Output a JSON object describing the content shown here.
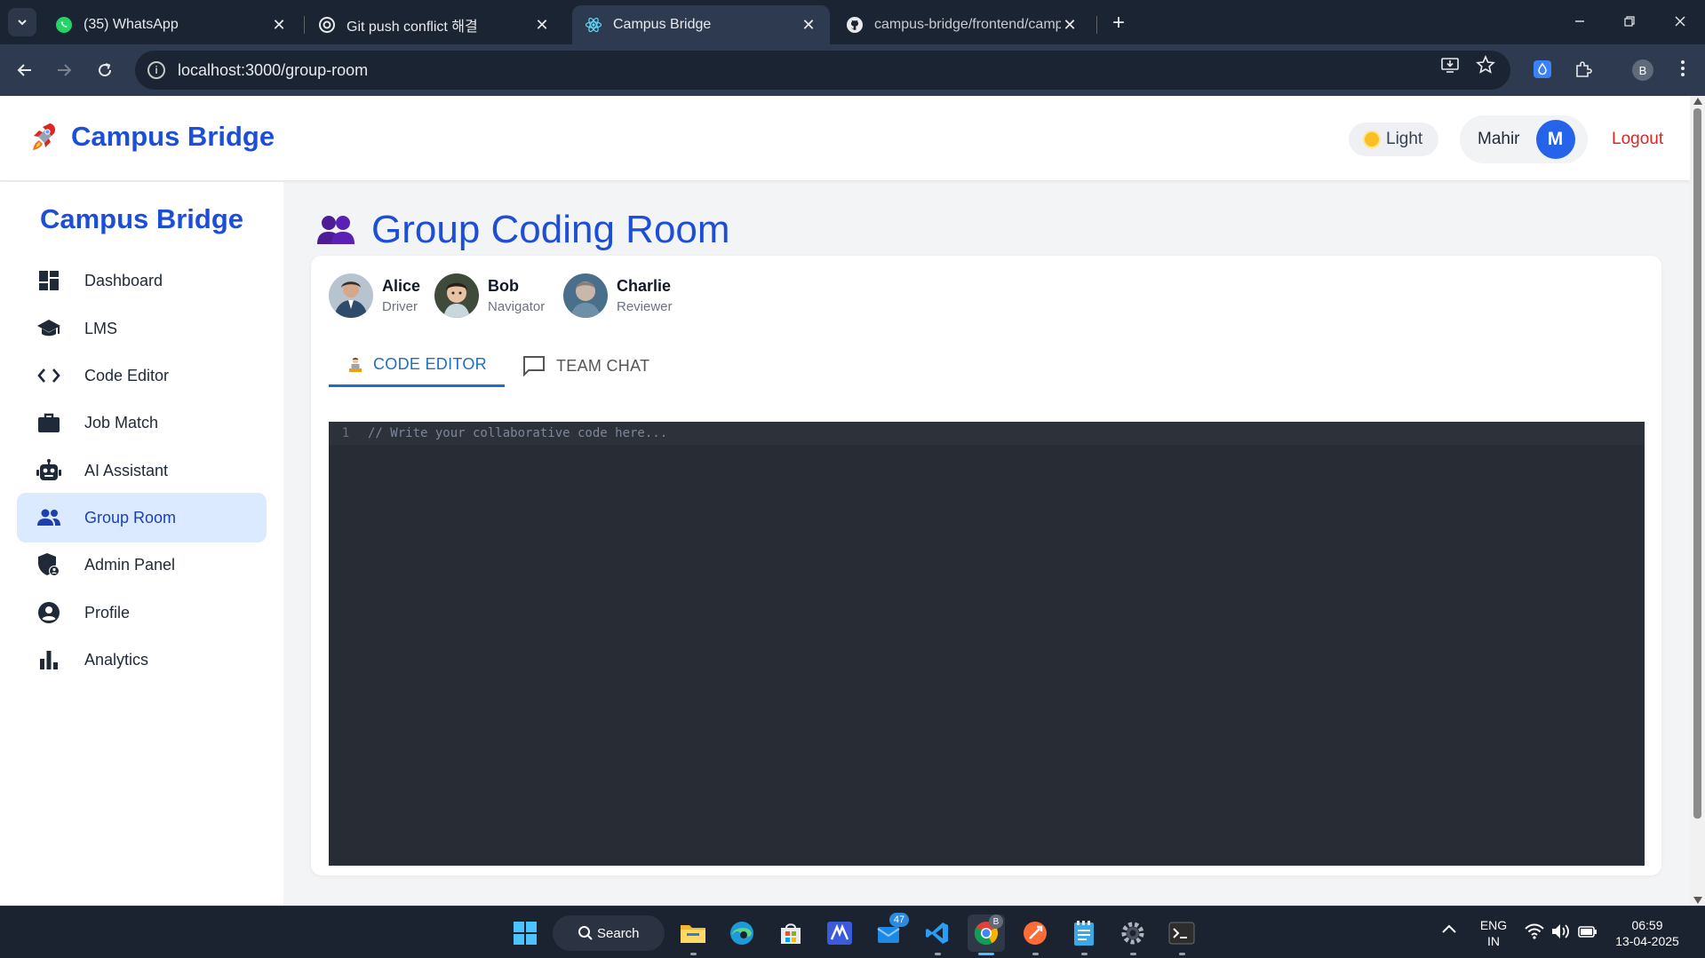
{
  "browser": {
    "tabs": [
      {
        "title": "(35) WhatsApp",
        "icon": "whatsapp-icon"
      },
      {
        "title": "Git push conflict 해결",
        "icon": "chatgpt-icon"
      },
      {
        "title": "Campus Bridge",
        "icon": "react-icon"
      },
      {
        "title": "campus-bridge/frontend/campu",
        "icon": "github-icon"
      }
    ],
    "url": "localhost:3000/group-room",
    "profile_initial": "B"
  },
  "header": {
    "brand": "Campus Bridge",
    "theme_label": "Light",
    "user_name": "Mahir",
    "user_initial": "M",
    "logout_label": "Logout",
    "accent": "#1d4ed8",
    "logout_color": "#dc2626"
  },
  "sidebar": {
    "title": "Campus Bridge",
    "items": [
      {
        "label": "Dashboard",
        "icon": "dashboard-icon"
      },
      {
        "label": "LMS",
        "icon": "graduation-cap-icon"
      },
      {
        "label": "Code Editor",
        "icon": "code-icon"
      },
      {
        "label": "Job Match",
        "icon": "briefcase-icon"
      },
      {
        "label": "AI Assistant",
        "icon": "robot-icon"
      },
      {
        "label": "Group Room",
        "icon": "group-icon",
        "active": true
      },
      {
        "label": "Admin Panel",
        "icon": "admin-shield-icon"
      },
      {
        "label": "Profile",
        "icon": "account-circle-icon"
      },
      {
        "label": "Analytics",
        "icon": "bar-chart-icon"
      }
    ]
  },
  "main": {
    "title": "Group Coding Room",
    "members": [
      {
        "name": "Alice",
        "role": "Driver"
      },
      {
        "name": "Bob",
        "role": "Navigator"
      },
      {
        "name": "Charlie",
        "role": "Reviewer"
      }
    ],
    "tabs": [
      {
        "label": "CODE EDITOR",
        "active": true
      },
      {
        "label": "TEAM CHAT",
        "active": false
      }
    ],
    "editor": {
      "line_number": "1",
      "placeholder": "// Write your collaborative code here..."
    }
  },
  "taskbar": {
    "search_label": "Search",
    "badge_count": "47",
    "chrome_badge": "B",
    "language": "ENG",
    "region": "IN",
    "time": "06:59",
    "date": "13-04-2025"
  }
}
